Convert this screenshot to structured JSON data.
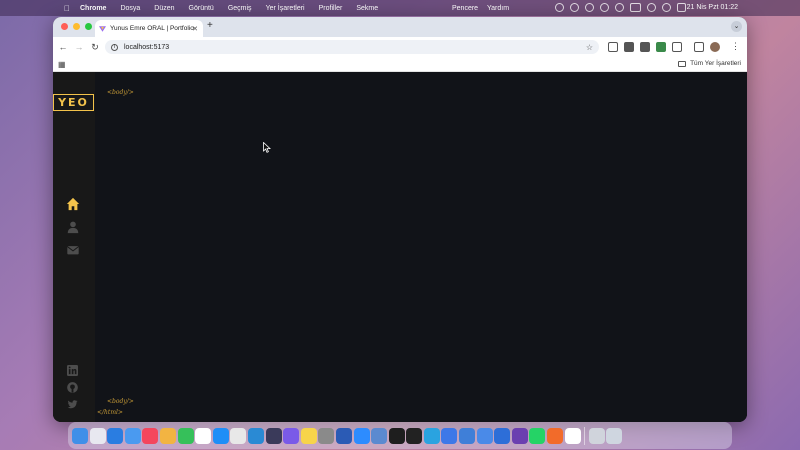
{
  "menubar": {
    "app_name": "Chrome",
    "items": [
      "Dosya",
      "Düzen",
      "Görüntü",
      "Geçmiş",
      "Yer İşaretleri",
      "Profiller",
      "Sekme"
    ],
    "right_items": [
      "Pencere",
      "Yardım"
    ],
    "clock": "21 Nis Pzt  01:22"
  },
  "browser": {
    "tab_title": "Yunus Emre ORAL | Portfolio",
    "url": "localhost:5173",
    "bookmarks_all": "Tüm Yer İşaretleri"
  },
  "page": {
    "logo": "YEO",
    "body_open_tag": "<body/>",
    "body_close_tag": "<body/>",
    "html_close_tag": "</html>",
    "accent_color": "#f3c34b",
    "sidebar_nav": [
      "home-icon",
      "user-icon",
      "envelope-icon"
    ],
    "social_links": [
      "linkedin-icon",
      "github-icon",
      "twitter-icon"
    ]
  },
  "dock": {
    "apps": [
      {
        "name": "finder",
        "color": "#3f8fe8"
      },
      {
        "name": "launchpad",
        "color": "#e8e8f0"
      },
      {
        "name": "safari",
        "color": "#2a7de1"
      },
      {
        "name": "mail",
        "color": "#4a9af0"
      },
      {
        "name": "music",
        "color": "#f4465d"
      },
      {
        "name": "photos",
        "color": "#f2b442"
      },
      {
        "name": "facetime",
        "color": "#36c05a"
      },
      {
        "name": "calendar",
        "color": "#ffffff"
      },
      {
        "name": "app-store",
        "color": "#1f8ef7"
      },
      {
        "name": "chrome",
        "color": "#e8e8e8"
      },
      {
        "name": "vscode",
        "color": "#2a8ad4"
      },
      {
        "name": "proxyman",
        "color": "#3a3a5a"
      },
      {
        "name": "imovie",
        "color": "#7a5ae8"
      },
      {
        "name": "notes",
        "color": "#f7d44a"
      },
      {
        "name": "system-settings",
        "color": "#8a8a8a"
      },
      {
        "name": "word",
        "color": "#2b5bb5"
      },
      {
        "name": "zoom",
        "color": "#2d8cff"
      },
      {
        "name": "preview",
        "color": "#5b8ad0"
      },
      {
        "name": "github-desktop",
        "color": "#1e1e1e"
      },
      {
        "name": "terminal",
        "color": "#222222"
      },
      {
        "name": "telegram",
        "color": "#2aa3e0"
      },
      {
        "name": "remote-desktop",
        "color": "#3d78e8"
      },
      {
        "name": "xcode",
        "color": "#3f7fd8"
      },
      {
        "name": "instruments",
        "color": "#4a8ae8"
      },
      {
        "name": "testflight",
        "color": "#2d6ed8"
      },
      {
        "name": "visual-studio",
        "color": "#6b3fb0"
      },
      {
        "name": "whatsapp",
        "color": "#25d366"
      },
      {
        "name": "pencil-app",
        "color": "#f26b2a"
      },
      {
        "name": "slack",
        "color": "#ffffff"
      },
      {
        "name": "archive",
        "color": "#d0d4dc"
      },
      {
        "name": "trash",
        "color": "#cfd6e0"
      }
    ]
  }
}
